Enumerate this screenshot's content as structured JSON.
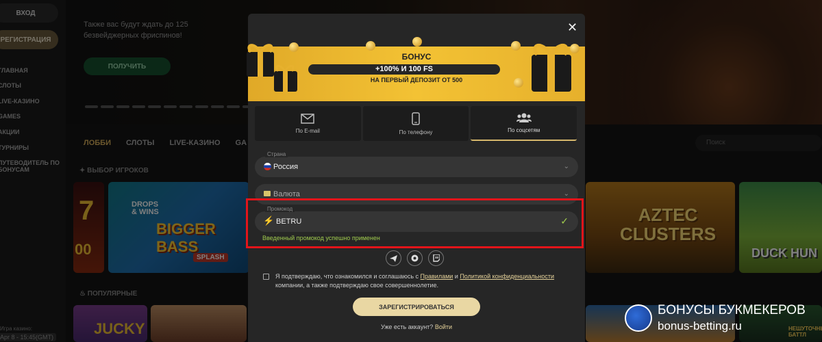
{
  "sidebar": {
    "login": "ВХОД",
    "register": "РЕГИСТРАЦИЯ",
    "items": [
      "ГЛАВНАЯ",
      "СЛОТЫ",
      "LIVE-КАЗИНО",
      "GAMES",
      "АКЦИИ",
      "ТУРНИРЫ",
      "ПУТЕВОДИТЕЛЬ ПО",
      "БОНУСАМ"
    ],
    "footer1": "Apr 8 - 15:45(GMT)"
  },
  "hero": {
    "text": "Также вас будут ждать до 125 безвейджерных фриспинов!",
    "button": "ПОЛУЧИТЬ"
  },
  "nav": {
    "items": [
      "ЛОББИ",
      "СЛОТЫ",
      "LIVE-КАЗИНО",
      "GA"
    ],
    "search_placeholder": "Поиск"
  },
  "sections": {
    "providers": "ВЫБОР ИГРОКОВ",
    "popular": "ПОПУЛЯРНЫЕ"
  },
  "tiles": {
    "drops": "DROPS & WINS",
    "bass": "BIGGER BASS",
    "splash": "SPLASH",
    "aztec": "AZTEC CLUSTERS",
    "duck": "DUCK HUN",
    "jucky": "JUCKY",
    "battle": "НЕШУТОЧНЫЕ БАТТЛ"
  },
  "modal": {
    "banner": {
      "title": "БОНУС",
      "offer": "+100% И 100 FS",
      "sub": "НА ПЕРВЫЙ ДЕПОЗИТ ОТ 500"
    },
    "tabs": [
      {
        "label": "По E-mail",
        "icon": "mail-icon"
      },
      {
        "label": "По телефону",
        "icon": "phone-icon"
      },
      {
        "label": "По соцсетям",
        "icon": "users-icon"
      }
    ],
    "country": {
      "label": "Страна",
      "value": "Россия"
    },
    "currency": {
      "value": "Валюта"
    },
    "promo": {
      "label": "Промокод",
      "value": "BETRU",
      "success": "Введенный промокод успешно применен"
    },
    "agree": {
      "prefix": "Я подтверждаю, что ознакомился и соглашаюсь с ",
      "rules": "Правилами",
      "and": " и ",
      "policy": "Политикой конфиденциальности",
      "suffix": " компании, а также подтверждаю свое совершеннолетие."
    },
    "register_button": "ЗАРЕГИСТРИРОВАТЬСЯ",
    "have_account": "Уже есть аккаунт?",
    "login_link": "Войти"
  },
  "watermark": {
    "line1": "БОНУСЫ БУКМЕКЕРОВ",
    "line2": "bonus-betting.ru"
  },
  "colors": {
    "accent": "#d7b86c",
    "banner": "#f3c234",
    "success": "#9fca4d",
    "highlight": "#e3141a"
  }
}
